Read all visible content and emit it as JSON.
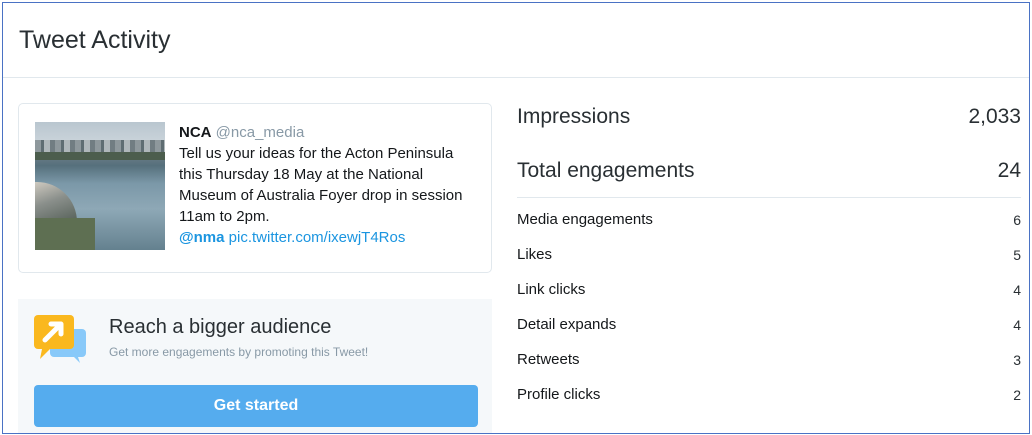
{
  "header": {
    "title": "Tweet Activity"
  },
  "tweet": {
    "name": "NCA",
    "handle": "@nca_media",
    "text": "Tell us your ideas for the Acton Peninsula this Thursday 18 May at the National Museum of Australia Foyer drop in session 11am to 2pm.",
    "mention": "@nma",
    "link": "pic.twitter.com/ixewjT4Ros"
  },
  "promote": {
    "icon": "megaphone-chat-icon",
    "title": "Reach a bigger audience",
    "subtitle": "Get more engagements by promoting this Tweet!",
    "button_label": "Get started"
  },
  "metrics": {
    "impressions": {
      "label": "Impressions",
      "value": "2,033"
    },
    "total_engagements": {
      "label": "Total engagements",
      "value": "24"
    },
    "breakdown": [
      {
        "label": "Media engagements",
        "value": "6"
      },
      {
        "label": "Likes",
        "value": "5"
      },
      {
        "label": "Link clicks",
        "value": "4"
      },
      {
        "label": "Detail expands",
        "value": "4"
      },
      {
        "label": "Retweets",
        "value": "3"
      },
      {
        "label": "Profile clicks",
        "value": "2"
      }
    ]
  },
  "colors": {
    "accent": "#55acee",
    "link": "#1b95e0",
    "icon_yellow": "#fab81e",
    "icon_blue": "#88c9f9"
  }
}
